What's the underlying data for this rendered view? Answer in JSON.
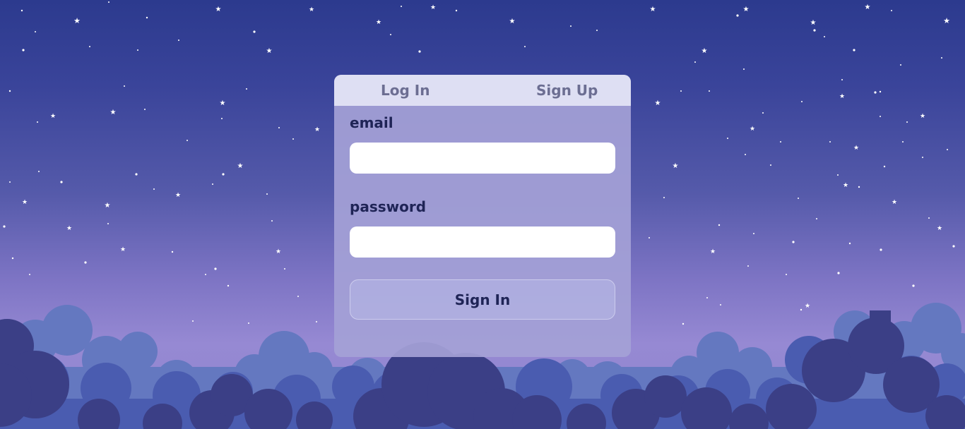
{
  "tabs": {
    "login_label": "Log In",
    "signup_label": "Sign Up"
  },
  "form": {
    "email_label": "email",
    "email_value": "",
    "password_label": "password",
    "password_value": "",
    "submit_label": "Sign In"
  },
  "colors": {
    "sky_top": "#2c3a8e",
    "sky_bottom": "#9689d3",
    "cloud_dark": "#3b3f86",
    "cloud_mid": "#4a5cb0",
    "cloud_light": "#6478c0",
    "tab_bar": "#dedff3",
    "card": "#a4a0d6",
    "label_text": "#1f2456"
  }
}
